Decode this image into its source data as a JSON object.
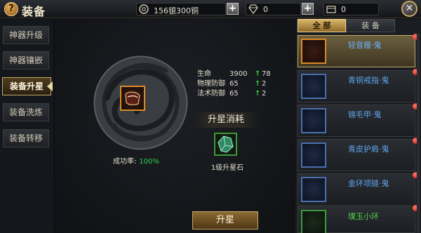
{
  "header": {
    "title": "装备",
    "help_icon": "question-icon",
    "close_icon": "close-icon"
  },
  "resources": {
    "money": "156银300铜",
    "diamond": "0",
    "crate": "0"
  },
  "nav": {
    "items": [
      "神器升级",
      "神器镶嵌",
      "装备升星",
      "装备洗炼",
      "装备转移"
    ],
    "active_index": 2
  },
  "equip": {
    "stats": [
      {
        "name": "生命",
        "value": "3900",
        "new": "78"
      },
      {
        "name": "物理防御",
        "value": "65",
        "new": "2"
      },
      {
        "name": "法术防御",
        "value": "65",
        "new": "2"
      }
    ],
    "cost_title": "升星消耗",
    "stone_label": "1级升星石",
    "rate_label": "成功率:",
    "rate_value": "100%",
    "upstar_button": "升星"
  },
  "tabs": {
    "all": "全  部",
    "equip": "装  备"
  },
  "list": [
    {
      "name": "轻音履·鬼",
      "color": "blue"
    },
    {
      "name": "青铜戒指·鬼",
      "color": "blue"
    },
    {
      "name": "锦毛甲·鬼",
      "color": "blue"
    },
    {
      "name": "青皮护肩·鬼",
      "color": "blue"
    },
    {
      "name": "金环项链·鬼",
      "color": "blue"
    },
    {
      "name": "璞玉小环",
      "color": "green"
    }
  ],
  "colors": {
    "gold": "#c9a867",
    "green": "#34d04a",
    "blue_text": "#5fa6ec",
    "red_dot": "#c4100a"
  }
}
